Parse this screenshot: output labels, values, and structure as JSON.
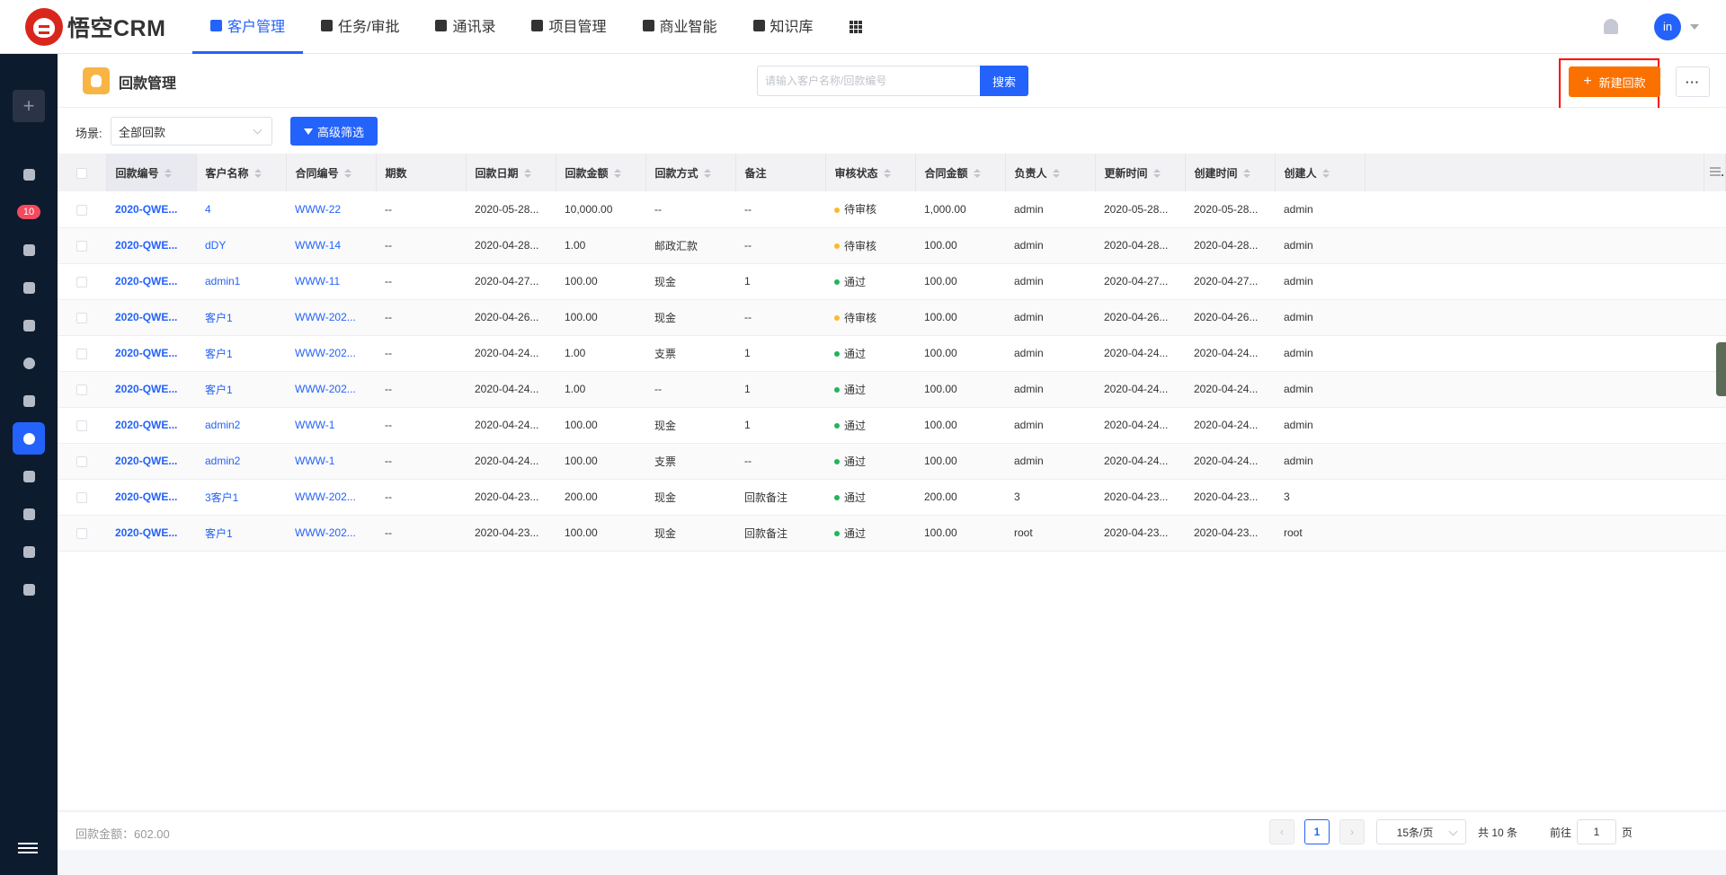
{
  "app": {
    "logo_text": "悟空CRM"
  },
  "nav": [
    {
      "label": "客户管理",
      "active": true
    },
    {
      "label": "任务/审批",
      "active": false
    },
    {
      "label": "通讯录",
      "active": false
    },
    {
      "label": "项目管理",
      "active": false
    },
    {
      "label": "商业智能",
      "active": false
    },
    {
      "label": "知识库",
      "active": false
    }
  ],
  "user": {
    "avatar_text": "in"
  },
  "sidebar": {
    "badge": "10"
  },
  "header": {
    "title": "回款管理",
    "search_placeholder": "请输入客户名称/回款编号",
    "search_label": "搜索",
    "new_label": "新建回款",
    "more_label": "···"
  },
  "filter": {
    "scene_label": "场景:",
    "scene_value": "全部回款",
    "advanced_label": "高级筛选"
  },
  "table": {
    "columns": [
      "回款编号",
      "客户名称",
      "合同编号",
      "期数",
      "回款日期",
      "回款金额",
      "回款方式",
      "备注",
      "审核状态",
      "合同金额",
      "负责人",
      "更新时间",
      "创建时间",
      "创建人"
    ],
    "rows": [
      [
        "2020-QWE...",
        "4",
        "WWW-22",
        "--",
        "2020-05-28...",
        "10,000.00",
        "--",
        "--",
        "待审核",
        "1,000.00",
        "admin",
        "2020-05-28...",
        "2020-05-28...",
        "admin"
      ],
      [
        "2020-QWE...",
        "dDY",
        "WWW-14",
        "--",
        "2020-04-28...",
        "1.00",
        "邮政汇款",
        "--",
        "待审核",
        "100.00",
        "admin",
        "2020-04-28...",
        "2020-04-28...",
        "admin"
      ],
      [
        "2020-QWE...",
        "admin1",
        "WWW-11",
        "--",
        "2020-04-27...",
        "100.00",
        "现金",
        "1",
        "通过",
        "100.00",
        "admin",
        "2020-04-27...",
        "2020-04-27...",
        "admin"
      ],
      [
        "2020-QWE...",
        "客户1",
        "WWW-202...",
        "--",
        "2020-04-26...",
        "100.00",
        "现金",
        "--",
        "待审核",
        "100.00",
        "admin",
        "2020-04-26...",
        "2020-04-26...",
        "admin"
      ],
      [
        "2020-QWE...",
        "客户1",
        "WWW-202...",
        "--",
        "2020-04-24...",
        "1.00",
        "支票",
        "1",
        "通过",
        "100.00",
        "admin",
        "2020-04-24...",
        "2020-04-24...",
        "admin"
      ],
      [
        "2020-QWE...",
        "客户1",
        "WWW-202...",
        "--",
        "2020-04-24...",
        "1.00",
        "--",
        "1",
        "通过",
        "100.00",
        "admin",
        "2020-04-24...",
        "2020-04-24...",
        "admin"
      ],
      [
        "2020-QWE...",
        "admin2",
        "WWW-1",
        "--",
        "2020-04-24...",
        "100.00",
        "现金",
        "1",
        "通过",
        "100.00",
        "admin",
        "2020-04-24...",
        "2020-04-24...",
        "admin"
      ],
      [
        "2020-QWE...",
        "admin2",
        "WWW-1",
        "--",
        "2020-04-24...",
        "100.00",
        "支票",
        "--",
        "通过",
        "100.00",
        "admin",
        "2020-04-24...",
        "2020-04-24...",
        "admin"
      ],
      [
        "2020-QWE...",
        "3客户1",
        "WWW-202...",
        "--",
        "2020-04-23...",
        "200.00",
        "现金",
        "回款备注",
        "通过",
        "200.00",
        "3",
        "2020-04-23...",
        "2020-04-23...",
        "3"
      ],
      [
        "2020-QWE...",
        "客户1",
        "WWW-202...",
        "--",
        "2020-04-23...",
        "100.00",
        "现金",
        "回款备注",
        "通过",
        "100.00",
        "root",
        "2020-04-23...",
        "2020-04-23...",
        "root"
      ]
    ],
    "status_colors": {
      "待审核": "#fdb92c",
      "通过": "#20b559"
    }
  },
  "footer": {
    "sum": "回款金额：602.00",
    "page": "1",
    "page_size": "15条/页",
    "total": "共 10 条",
    "goto_label": "前往",
    "goto_value": "1",
    "page_unit": "页"
  }
}
